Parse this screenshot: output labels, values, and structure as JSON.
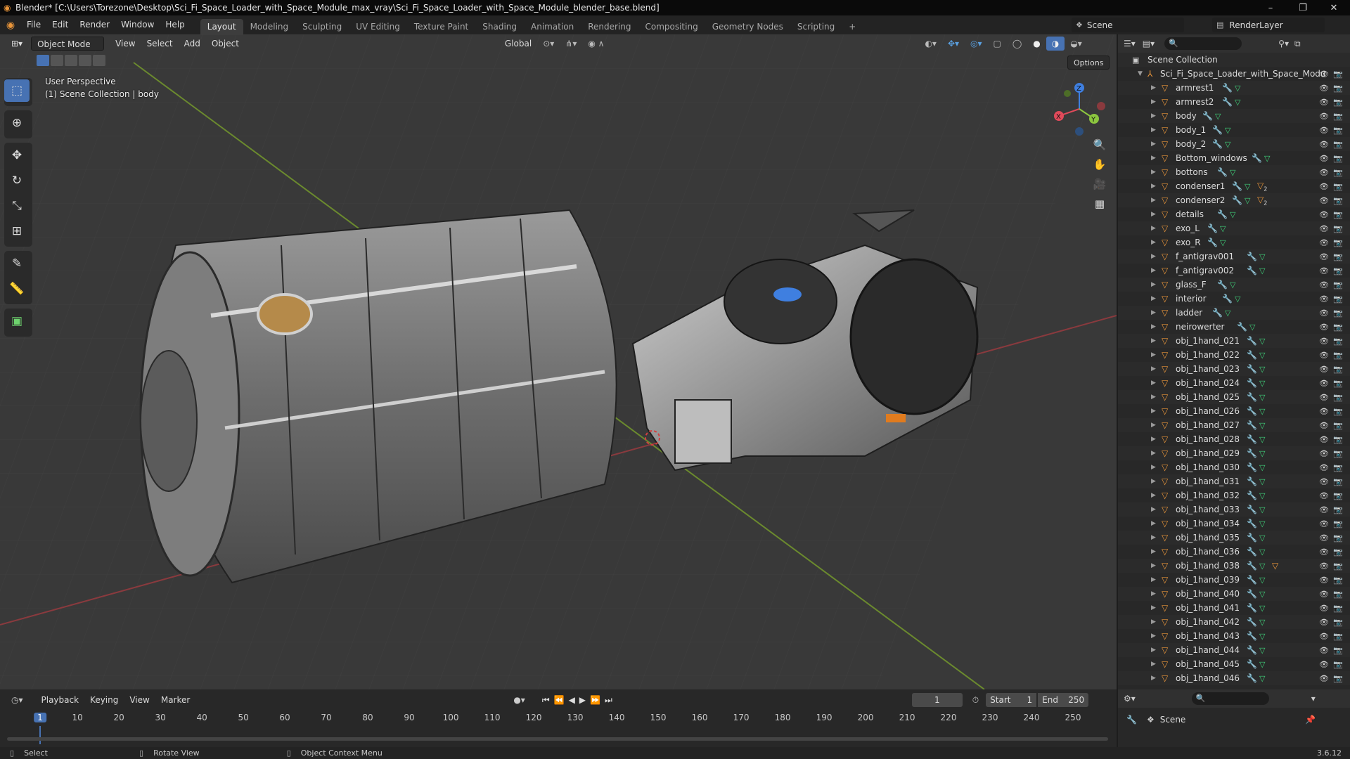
{
  "window": {
    "title": "Blender* [C:\\Users\\Torezone\\Desktop\\Sci_Fi_Space_Loader_with_Space_Module_max_vray\\Sci_Fi_Space_Loader_with_Space_Module_blender_base.blend]",
    "minimize": "–",
    "maximize": "❐",
    "close": "✕"
  },
  "menus": [
    "File",
    "Edit",
    "Render",
    "Window",
    "Help"
  ],
  "workspaces": [
    "Layout",
    "Modeling",
    "Sculpting",
    "UV Editing",
    "Texture Paint",
    "Shading",
    "Animation",
    "Rendering",
    "Compositing",
    "Geometry Nodes",
    "Scripting"
  ],
  "workspace_add": "+",
  "active_workspace": "Layout",
  "scene": {
    "name": "Scene",
    "render_layer": "RenderLayer"
  },
  "viewport": {
    "mode": "Object Mode",
    "menus": [
      "View",
      "Select",
      "Add",
      "Object"
    ],
    "orientation": "Global",
    "options": "Options",
    "overlay_line1": "User Perspective",
    "overlay_line2": "(1) Scene Collection | body",
    "gizmo": {
      "x": "X",
      "y": "Y",
      "z": "Z"
    }
  },
  "outliner": {
    "root": "Scene Collection",
    "collection": "Sci_Fi_Space_Loader_with_Space_Modu",
    "items": [
      {
        "name": "armrest1",
        "extra": ""
      },
      {
        "name": "armrest2",
        "extra": ""
      },
      {
        "name": "body",
        "extra": ""
      },
      {
        "name": "body_1",
        "extra": ""
      },
      {
        "name": "body_2",
        "extra": ""
      },
      {
        "name": "Bottom_windows",
        "extra": ""
      },
      {
        "name": "bottons",
        "extra": ""
      },
      {
        "name": "condenser1",
        "extra": "2"
      },
      {
        "name": "condenser2",
        "extra": "2"
      },
      {
        "name": "details",
        "extra": ""
      },
      {
        "name": "exo_L",
        "extra": ""
      },
      {
        "name": "exo_R",
        "extra": ""
      },
      {
        "name": "f_antigrav001",
        "extra": ""
      },
      {
        "name": "f_antigrav002",
        "extra": ""
      },
      {
        "name": "glass_F",
        "extra": ""
      },
      {
        "name": "interior",
        "extra": ""
      },
      {
        "name": "ladder",
        "extra": ""
      },
      {
        "name": "neirowerter",
        "extra": ""
      },
      {
        "name": "obj_1hand_021",
        "extra": ""
      },
      {
        "name": "obj_1hand_022",
        "extra": ""
      },
      {
        "name": "obj_1hand_023",
        "extra": ""
      },
      {
        "name": "obj_1hand_024",
        "extra": ""
      },
      {
        "name": "obj_1hand_025",
        "extra": ""
      },
      {
        "name": "obj_1hand_026",
        "extra": ""
      },
      {
        "name": "obj_1hand_027",
        "extra": ""
      },
      {
        "name": "obj_1hand_028",
        "extra": ""
      },
      {
        "name": "obj_1hand_029",
        "extra": ""
      },
      {
        "name": "obj_1hand_030",
        "extra": ""
      },
      {
        "name": "obj_1hand_031",
        "extra": ""
      },
      {
        "name": "obj_1hand_032",
        "extra": ""
      },
      {
        "name": "obj_1hand_033",
        "extra": ""
      },
      {
        "name": "obj_1hand_034",
        "extra": ""
      },
      {
        "name": "obj_1hand_035",
        "extra": ""
      },
      {
        "name": "obj_1hand_036",
        "extra": ""
      },
      {
        "name": "obj_1hand_038",
        "extra": "tri"
      },
      {
        "name": "obj_1hand_039",
        "extra": ""
      },
      {
        "name": "obj_1hand_040",
        "extra": ""
      },
      {
        "name": "obj_1hand_041",
        "extra": ""
      },
      {
        "name": "obj_1hand_042",
        "extra": ""
      },
      {
        "name": "obj_1hand_043",
        "extra": ""
      },
      {
        "name": "obj_1hand_044",
        "extra": ""
      },
      {
        "name": "obj_1hand_045",
        "extra": ""
      },
      {
        "name": "obj_1hand_046",
        "extra": ""
      }
    ]
  },
  "timeline": {
    "menus": [
      "Playback",
      "Keying",
      "View",
      "Marker"
    ],
    "current_frame": "1",
    "start_label": "Start",
    "start": "1",
    "end_label": "End",
    "end": "250",
    "ticks": [
      "1",
      "10",
      "20",
      "30",
      "40",
      "50",
      "60",
      "70",
      "80",
      "90",
      "100",
      "110",
      "120",
      "130",
      "140",
      "150",
      "160",
      "170",
      "180",
      "190",
      "200",
      "210",
      "220",
      "230",
      "240",
      "250"
    ]
  },
  "properties": {
    "scene_label": "Scene"
  },
  "statusbar": {
    "select": "Select",
    "rotate": "Rotate View",
    "context": "Object Context Menu",
    "version": "3.6.12"
  },
  "colors": {
    "accent": "#4772b3",
    "x_axis": "#e04a5a",
    "y_axis": "#8cc63f",
    "z_axis": "#3f7fe0",
    "object_orange": "#e8953a"
  }
}
